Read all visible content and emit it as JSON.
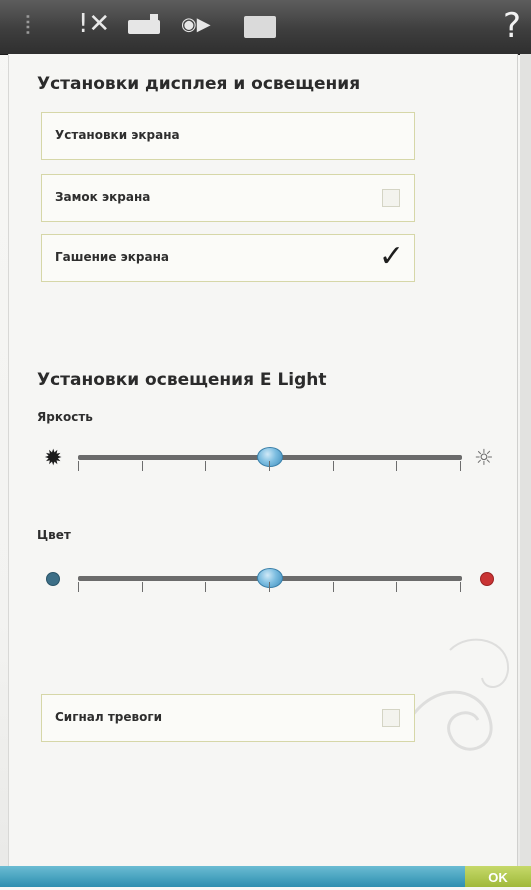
{
  "toolbar": {
    "help_label": "?",
    "icons": [
      "grip-icon",
      "scissors-icon",
      "presser-foot-icon",
      "sound-icon",
      "card-icon",
      "help-icon"
    ]
  },
  "display_section": {
    "title": "Установки дисплея и освещения",
    "rows": [
      {
        "label": "Установки экрана",
        "has_checkbox": false
      },
      {
        "label": "Замок экрана",
        "checked": false
      },
      {
        "label": "Гашение экрана",
        "checked": true
      }
    ],
    "checkmark_glyph": "✓"
  },
  "light_section": {
    "title": "Установки освещения E Light",
    "brightness": {
      "label": "Яркость",
      "level": 0.5
    },
    "color": {
      "label": "Цвет",
      "level": 0.5
    },
    "ticks": 7,
    "accent_colors": {
      "cool": "#3d6f87",
      "warm": "#c93434",
      "thumb": "#6fb6dc"
    }
  },
  "alarm": {
    "label": "Сигнал тревоги",
    "checked": false
  },
  "footer": {
    "ok_label": "OK",
    "bar_color": "#2d8fb0",
    "ok_color": "#a8c043"
  }
}
